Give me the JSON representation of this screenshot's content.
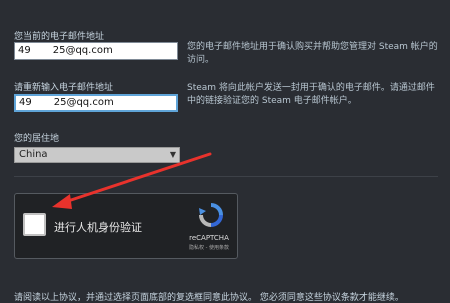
{
  "form": {
    "current_email_label": "您当前的电子邮件地址",
    "current_email_prefix": "49",
    "current_email_suffix": "25@qq.com",
    "current_email_note": "您的电子邮件地址用于确认购买并帮助您管理对 Steam 帐户的访问。",
    "reenter_email_label": "请重新输入电子邮件地址",
    "reenter_email_prefix": "49",
    "reenter_email_suffix": "25@qq.com",
    "reenter_email_note": "Steam 将向此帐户发送一封用于确认的电子邮件。请通过邮件中的链接验证您的 Steam 电子邮件帐户。",
    "country_label": "您的居住地",
    "country_value": "China",
    "country_arrow": "▼"
  },
  "captcha": {
    "label": "进行人机身份验证",
    "brand": "reCAPTCHA",
    "links": "隐私权 - 使用条款"
  },
  "footer": {
    "text": "请阅读以上协议，并通过选择页面底部的复选框同意此协议。 您必须同意这些协议条款才能继续。"
  },
  "colors": {
    "background": "#2a2d33",
    "focus_border": "#5fa4d8",
    "annotation_arrow": "#e8322c"
  }
}
